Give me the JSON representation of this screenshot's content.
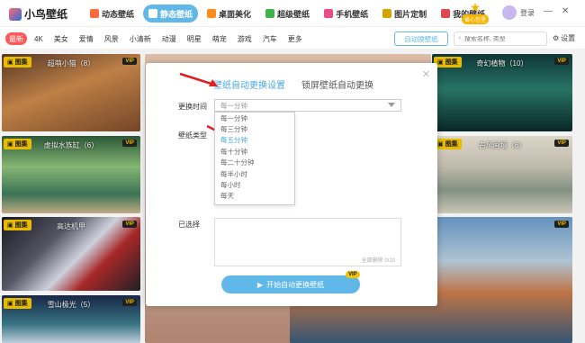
{
  "app": {
    "name": "小鸟壁纸"
  },
  "nav": [
    {
      "label": "动态壁纸",
      "color": "#ff6a3d"
    },
    {
      "label": "静态壁纸",
      "color": "#ffffff",
      "active": true
    },
    {
      "label": "桌面美化",
      "color": "#ff8c1a"
    },
    {
      "label": "超级壁纸",
      "color": "#3bb54a"
    },
    {
      "label": "手机壁纸",
      "color": "#e84d8a"
    },
    {
      "label": "图片定制",
      "color": "#d6a400"
    },
    {
      "label": "我的壁纸",
      "color": "#e0464e"
    }
  ],
  "promo": {
    "label": "省心包里"
  },
  "user": {
    "login": "登录"
  },
  "categories": [
    "最新",
    "4K",
    "美女",
    "爱情",
    "风景",
    "小清新",
    "动漫",
    "明星",
    "萌宠",
    "游戏",
    "汽车",
    "更多"
  ],
  "toolbar": {
    "auto_change": "自动换壁纸",
    "search_placeholder": "搜索名称, 类型",
    "settings": "设置"
  },
  "cards": {
    "left": [
      {
        "badge": "图集",
        "title": "超萌小猫（8）",
        "vip": "VIP"
      },
      {
        "badge": "图集",
        "title": "虚拟水族缸（6）",
        "vip": "VIP"
      },
      {
        "badge": "图集",
        "title": "高达机甲",
        "vip": "VIP"
      },
      {
        "badge": "图集",
        "title": "雪山极光（5）",
        "vip": "VIP"
      }
    ],
    "right": [
      {
        "badge": "图集",
        "title": "奇幻植物（10）",
        "vip": "VIP"
      },
      {
        "badge": "图集",
        "title": "古风画境（6）",
        "vip": "VIP"
      },
      {
        "badge": "",
        "title": "",
        "vip": "VIP"
      }
    ]
  },
  "modal": {
    "tab_auto": "壁纸自动更换设置",
    "tab_lock": "锁屏壁纸自动更换",
    "interval_label": "更换时间",
    "interval_value": "每一分钟",
    "type_label": "壁纸类型",
    "interval_options": [
      "每一分钟",
      "每三分钟",
      "每五分钟",
      "每十分钟",
      "每二十分钟",
      "每半小时",
      "每小时",
      "每天"
    ],
    "hovered_option": "每五分钟",
    "selected_label": "已选择",
    "clear_all": "全部删除",
    "count": "0/10",
    "start_button": "开始自动更换壁纸",
    "start_vip": "VIP"
  }
}
